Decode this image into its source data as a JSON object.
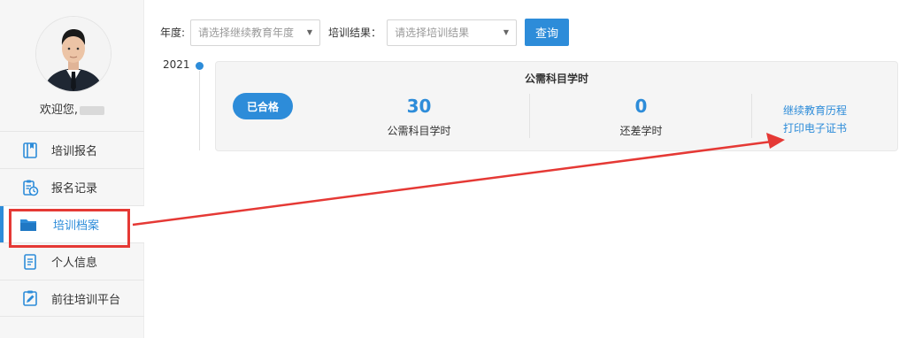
{
  "user": {
    "welcome": "欢迎您,"
  },
  "sidebar": {
    "items": [
      {
        "label": "培训报名",
        "icon": "book-icon"
      },
      {
        "label": "报名记录",
        "icon": "clipboard-clock-icon"
      },
      {
        "label": "培训档案",
        "icon": "folder-icon"
      },
      {
        "label": "个人信息",
        "icon": "document-icon"
      },
      {
        "label": "前往培训平台",
        "icon": "clipboard-edit-icon"
      }
    ],
    "active_index": 2
  },
  "filter": {
    "year_label": "年度:",
    "year_placeholder": "请选择继续教育年度",
    "result_label": "培训结果：",
    "result_placeholder": "请选择培训结果",
    "query_label": "查询"
  },
  "timeline": {
    "year": "2021",
    "card": {
      "title": "公需科目学时",
      "badge": "已合格",
      "stats": [
        {
          "value": "30",
          "label": "公需科目学时"
        },
        {
          "value": "0",
          "label": "还差学时"
        }
      ],
      "links": [
        "继续教育历程",
        "打印电子证书"
      ]
    }
  },
  "colors": {
    "accent": "#2d8cd9",
    "annotation": "#e53935"
  }
}
